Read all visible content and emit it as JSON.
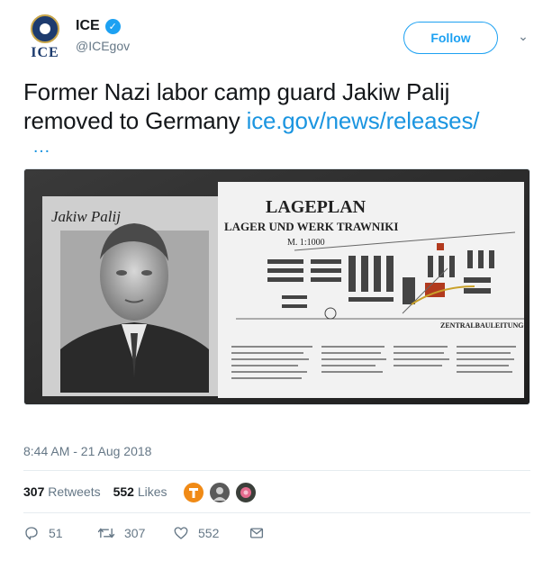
{
  "user": {
    "display_name": "ICE",
    "handle": "@ICEgov",
    "avatar_text": "ICE"
  },
  "follow_label": "Follow",
  "tweet": {
    "text": "Former Nazi labor camp guard Jakiw Palij removed to Germany ",
    "link": "ice.gov/news/releases/",
    "ellipsis": "…"
  },
  "media": {
    "signature": "Jakiw Palij",
    "map_title": "LAGEPLAN",
    "map_subtitle": "LAGER UND WERK TRAWNIKI",
    "map_scale": "M. 1:1000",
    "map_stamp": "ZENTRALBAULEITUNG DER WAFFEN-SS U. POLIZEI"
  },
  "timestamp": "8:44 AM - 21 Aug 2018",
  "stats": {
    "retweets_count": "307",
    "retweets_label": "Retweets",
    "likes_count": "552",
    "likes_label": "Likes"
  },
  "actions": {
    "replies": "51",
    "retweets": "307",
    "likes": "552"
  },
  "colors": {
    "accent": "#1da1f2",
    "link": "#1b95e0",
    "muted": "#657786"
  }
}
